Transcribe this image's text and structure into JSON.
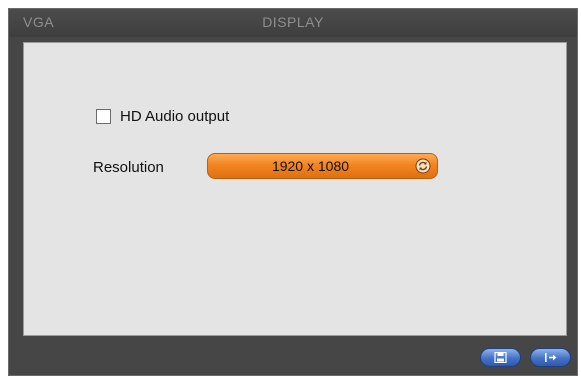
{
  "window": {
    "title_left": "VGA",
    "title_center": "DISPLAY"
  },
  "settings": {
    "hd_audio": {
      "label": "HD Audio output",
      "checked": false
    },
    "resolution": {
      "label": "Resolution",
      "value": "1920 x 1080",
      "icon": "refresh-icon"
    }
  },
  "footer": {
    "buttons": [
      {
        "icon": "save-icon"
      },
      {
        "icon": "exit-icon"
      }
    ]
  },
  "colors": {
    "frame": "#464646",
    "panel": "#e4e4e4",
    "dropdown_accent": "#f28522",
    "button_accent": "#4472c6",
    "title_text": "#8e8e8e"
  }
}
